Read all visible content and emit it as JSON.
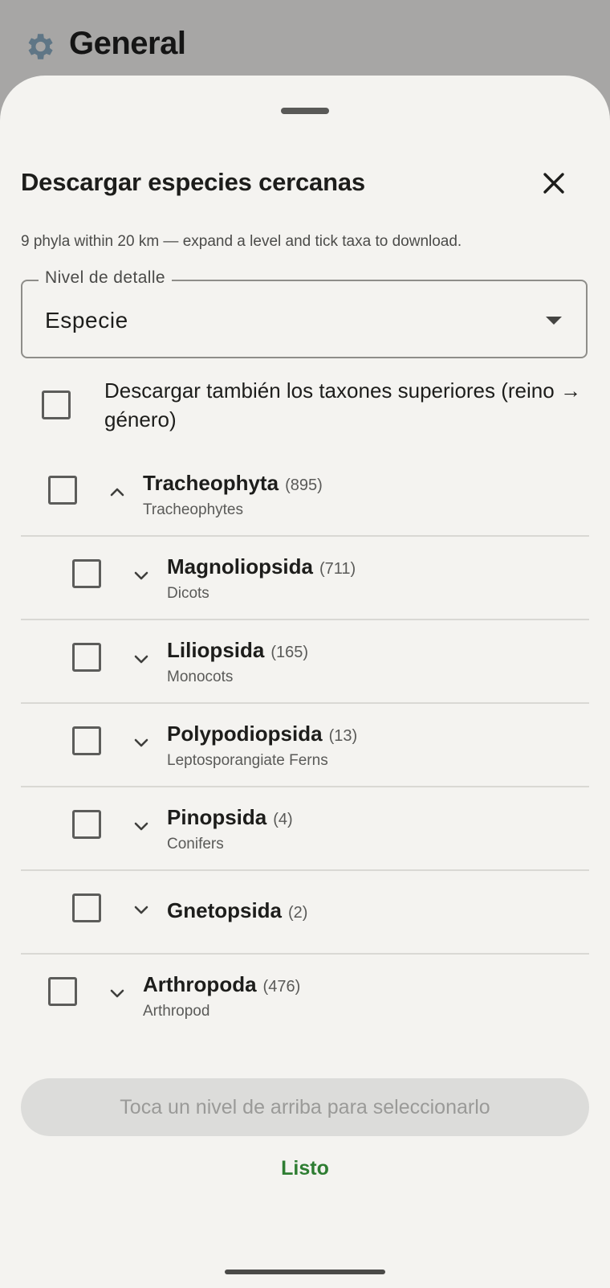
{
  "background_header": {
    "title": "General",
    "gear_icon": "gear-icon"
  },
  "sheet": {
    "title": "Descargar especies cercanas",
    "subtitle": "9 phyla within 20 km — expand a level and tick taxa to download.",
    "detail_level": {
      "label": "Nivel de detalle",
      "value": "Especie"
    },
    "upper_taxa_checkbox": {
      "label": "Descargar también los taxones superiores (reino → género)",
      "checked": false
    },
    "taxa": [
      {
        "name": "Tracheophyta",
        "count": "(895)",
        "common": "Tracheophytes",
        "expanded": true,
        "level": 0,
        "checked": false
      },
      {
        "name": "Magnoliopsida",
        "count": "(711)",
        "common": "Dicots",
        "expanded": false,
        "level": 1,
        "checked": false
      },
      {
        "name": "Liliopsida",
        "count": "(165)",
        "common": "Monocots",
        "expanded": false,
        "level": 1,
        "checked": false
      },
      {
        "name": "Polypodiopsida",
        "count": "(13)",
        "common": "Leptosporangiate Ferns",
        "expanded": false,
        "level": 1,
        "checked": false
      },
      {
        "name": "Pinopsida",
        "count": "(4)",
        "common": "Conifers",
        "expanded": false,
        "level": 1,
        "checked": false
      },
      {
        "name": "Gnetopsida",
        "count": "(2)",
        "common": "",
        "expanded": false,
        "level": 1,
        "checked": false
      },
      {
        "name": "Arthropoda",
        "count": "(476)",
        "common": "Arthropod",
        "expanded": false,
        "level": 0,
        "checked": false
      }
    ],
    "action_button": {
      "label": "Toca un nivel de arriba para seleccionarlo",
      "enabled": false
    },
    "done_button": {
      "label": "Listo"
    }
  },
  "colors": {
    "accent_green": "#2e7d32",
    "sheet_bg": "#f4f3f0",
    "scrim": "#a7a6a5"
  }
}
